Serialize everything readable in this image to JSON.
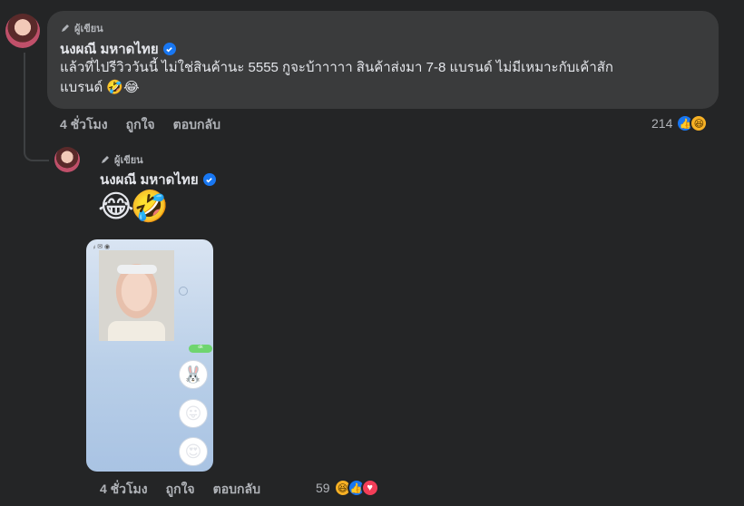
{
  "comment": {
    "author_badge": "ผู้เขียน",
    "author_name": "นงผณี มหาดไทย",
    "text_line1": "แล้วที่ไปรีวิววันนี้ ไม่ใช่สินค้านะ 5555 กูจะบ้าาาาา สินค้าส่งมา 7-8 แบรนด์ ไม่มีเหมาะกับเค้าสัก",
    "text_line2": "แบรนด์ 🤣😂",
    "time": "4 ชั่วโมง",
    "like_label": "ถูกใจ",
    "reply_label": "ตอบกลับ",
    "reaction_count": "214"
  },
  "reply": {
    "author_badge": "ผู้เขียน",
    "author_name": "นงผณี มหาดไทย",
    "emojis": "😂🤣",
    "time": "4 ชั่วโมง",
    "like_label": "ถูกใจ",
    "reply_label": "ตอบกลับ",
    "reaction_count": "59"
  },
  "photo": {
    "status_text": "ᵢₗ ✉ ◉",
    "green_bubble_text": "ok"
  },
  "icons": {
    "verified": "verified-check-icon",
    "author": "pencil-icon",
    "reactions_comment": [
      "like-icon",
      "haha-icon"
    ],
    "reactions_reply": [
      "haha-icon",
      "like-icon",
      "love-icon"
    ]
  },
  "colors": {
    "background": "#242526",
    "bubble": "#3a3b3c",
    "verified": "#1877f2",
    "text_primary": "#e4e6eb",
    "text_secondary": "#b0b3b8"
  }
}
